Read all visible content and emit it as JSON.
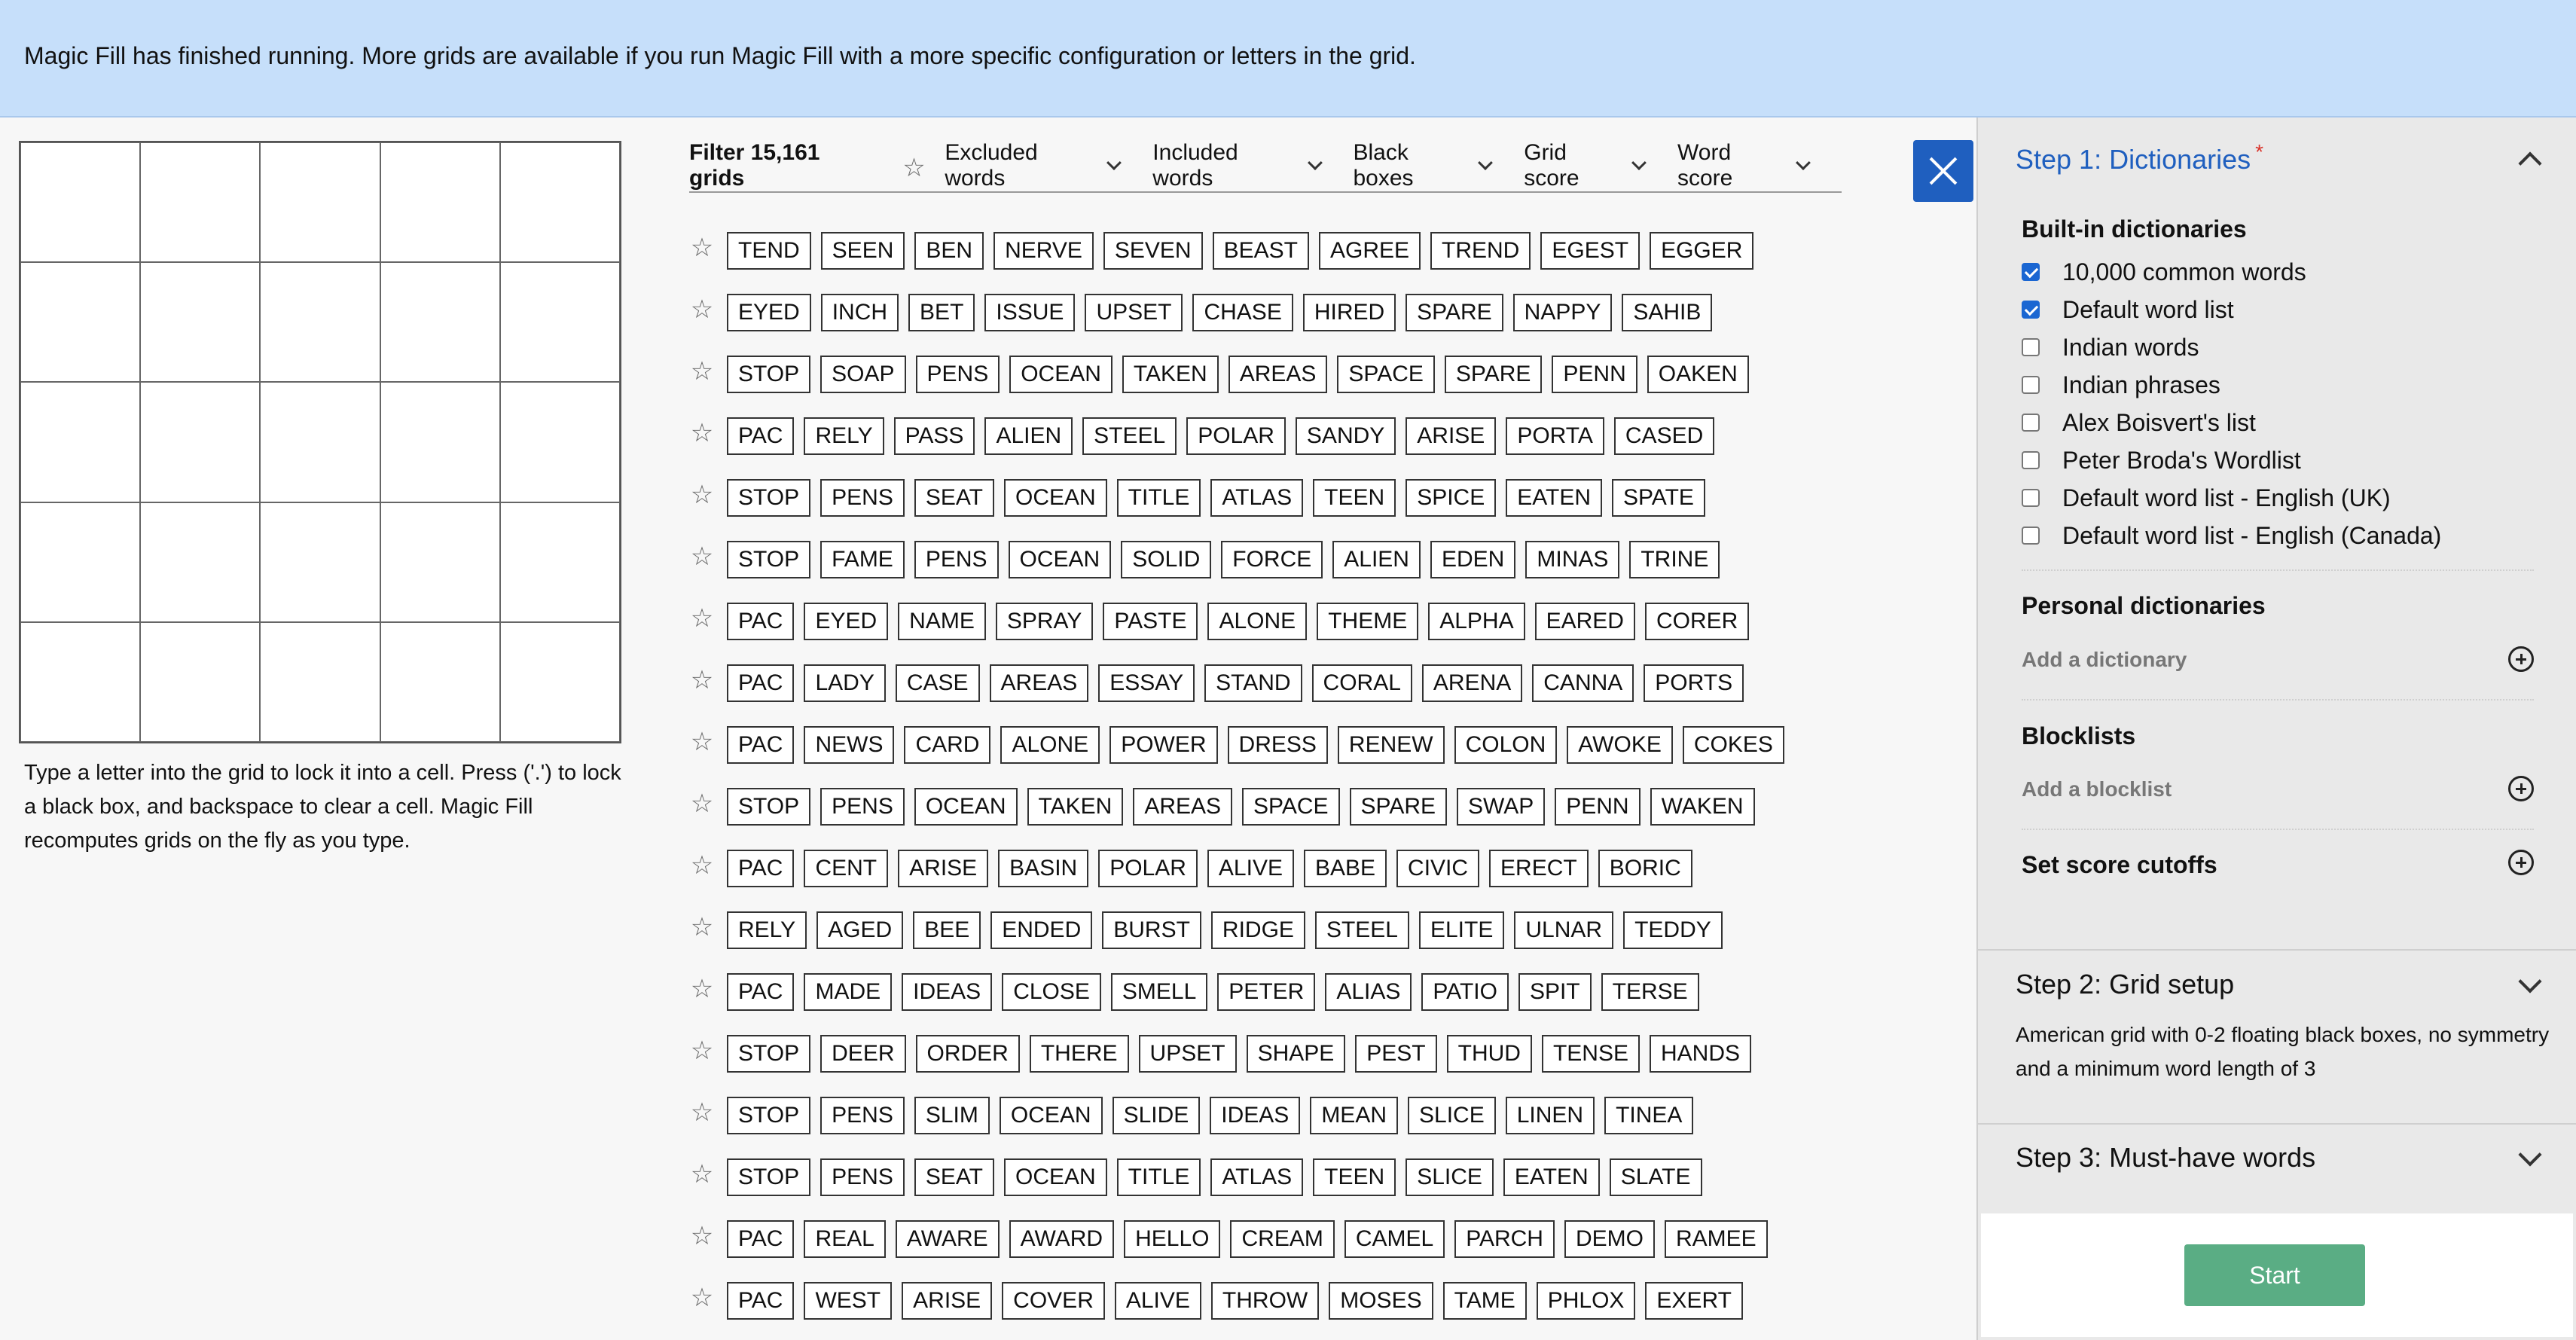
{
  "banner": {
    "message": "Magic Fill has finished running. More grids are available if you run Magic Fill with a more specific configuration or letters in the grid."
  },
  "grid": {
    "help_text": "Type a letter into the grid to lock it into a cell. Press ('.') to lock a black box, and backspace to clear a cell. Magic Fill recomputes grids on the fly as you type."
  },
  "filter": {
    "count_label": "Filter 15,161 grids",
    "dropdowns": [
      "Excluded words",
      "Included words",
      "Black boxes",
      "Grid score",
      "Word score"
    ]
  },
  "results": [
    [
      "TEND",
      "SEEN",
      "BEN",
      "NERVE",
      "SEVEN",
      "BEAST",
      "AGREE",
      "TREND",
      "EGEST",
      "EGGER"
    ],
    [
      "EYED",
      "INCH",
      "BET",
      "ISSUE",
      "UPSET",
      "CHASE",
      "HIRED",
      "SPARE",
      "NAPPY",
      "SAHIB"
    ],
    [
      "STOP",
      "SOAP",
      "PENS",
      "OCEAN",
      "TAKEN",
      "AREAS",
      "SPACE",
      "SPARE",
      "PENN",
      "OAKEN"
    ],
    [
      "PAC",
      "RELY",
      "PASS",
      "ALIEN",
      "STEEL",
      "POLAR",
      "SANDY",
      "ARISE",
      "PORTA",
      "CASED"
    ],
    [
      "STOP",
      "PENS",
      "SEAT",
      "OCEAN",
      "TITLE",
      "ATLAS",
      "TEEN",
      "SPICE",
      "EATEN",
      "SPATE"
    ],
    [
      "STOP",
      "FAME",
      "PENS",
      "OCEAN",
      "SOLID",
      "FORCE",
      "ALIEN",
      "EDEN",
      "MINAS",
      "TRINE"
    ],
    [
      "PAC",
      "EYED",
      "NAME",
      "SPRAY",
      "PASTE",
      "ALONE",
      "THEME",
      "ALPHA",
      "EARED",
      "CORER"
    ],
    [
      "PAC",
      "LADY",
      "CASE",
      "AREAS",
      "ESSAY",
      "STAND",
      "CORAL",
      "ARENA",
      "CANNA",
      "PORTS"
    ],
    [
      "PAC",
      "NEWS",
      "CARD",
      "ALONE",
      "POWER",
      "DRESS",
      "RENEW",
      "COLON",
      "AWOKE",
      "COKES"
    ],
    [
      "STOP",
      "PENS",
      "OCEAN",
      "TAKEN",
      "AREAS",
      "SPACE",
      "SPARE",
      "SWAP",
      "PENN",
      "WAKEN"
    ],
    [
      "PAC",
      "CENT",
      "ARISE",
      "BASIN",
      "POLAR",
      "ALIVE",
      "BABE",
      "CIVIC",
      "ERECT",
      "BORIC"
    ],
    [
      "RELY",
      "AGED",
      "BEE",
      "ENDED",
      "BURST",
      "RIDGE",
      "STEEL",
      "ELITE",
      "ULNAR",
      "TEDDY"
    ],
    [
      "PAC",
      "MADE",
      "IDEAS",
      "CLOSE",
      "SMELL",
      "PETER",
      "ALIAS",
      "PATIO",
      "SPIT",
      "TERSE"
    ],
    [
      "STOP",
      "DEER",
      "ORDER",
      "THERE",
      "UPSET",
      "SHAPE",
      "PEST",
      "THUD",
      "TENSE",
      "HANDS"
    ],
    [
      "STOP",
      "PENS",
      "SLIM",
      "OCEAN",
      "SLIDE",
      "IDEAS",
      "MEAN",
      "SLICE",
      "LINEN",
      "TINEA"
    ],
    [
      "STOP",
      "PENS",
      "SEAT",
      "OCEAN",
      "TITLE",
      "ATLAS",
      "TEEN",
      "SLICE",
      "EATEN",
      "SLATE"
    ],
    [
      "PAC",
      "REAL",
      "AWARE",
      "AWARD",
      "HELLO",
      "CREAM",
      "CAMEL",
      "PARCH",
      "DEMO",
      "RAMEE"
    ],
    [
      "PAC",
      "WEST",
      "ARISE",
      "COVER",
      "ALIVE",
      "THROW",
      "MOSES",
      "TAME",
      "PHLOX",
      "EXERT"
    ]
  ],
  "sidebar": {
    "step1": {
      "title": "Step 1: Dictionaries",
      "required_mark": "*",
      "builtin_title": "Built-in dictionaries",
      "builtin": [
        {
          "label": "10,000 common words",
          "checked": true
        },
        {
          "label": "Default word list",
          "checked": true
        },
        {
          "label": "Indian words",
          "checked": false
        },
        {
          "label": "Indian phrases",
          "checked": false
        },
        {
          "label": "Alex Boisvert's list",
          "checked": false
        },
        {
          "label": "Peter Broda's Wordlist",
          "checked": false
        },
        {
          "label": "Default word list - English (UK)",
          "checked": false
        },
        {
          "label": "Default word list - English (Canada)",
          "checked": false
        }
      ],
      "personal_title": "Personal dictionaries",
      "add_dictionary": "Add a dictionary",
      "blocklists_title": "Blocklists",
      "add_blocklist": "Add a blocklist",
      "score_cutoffs": "Set score cutoffs"
    },
    "step2": {
      "title": "Step 2: Grid setup",
      "description": "American grid with 0-2 floating black boxes, no symmetry and a minimum word length of 3"
    },
    "step3": {
      "title": "Step 3: Must-have words"
    },
    "start_label": "Start"
  },
  "colors": {
    "banner_bg": "#c6dffa",
    "accent_blue": "#1f5fbf",
    "start_green": "#5aad84",
    "required_red": "#d9342b"
  }
}
